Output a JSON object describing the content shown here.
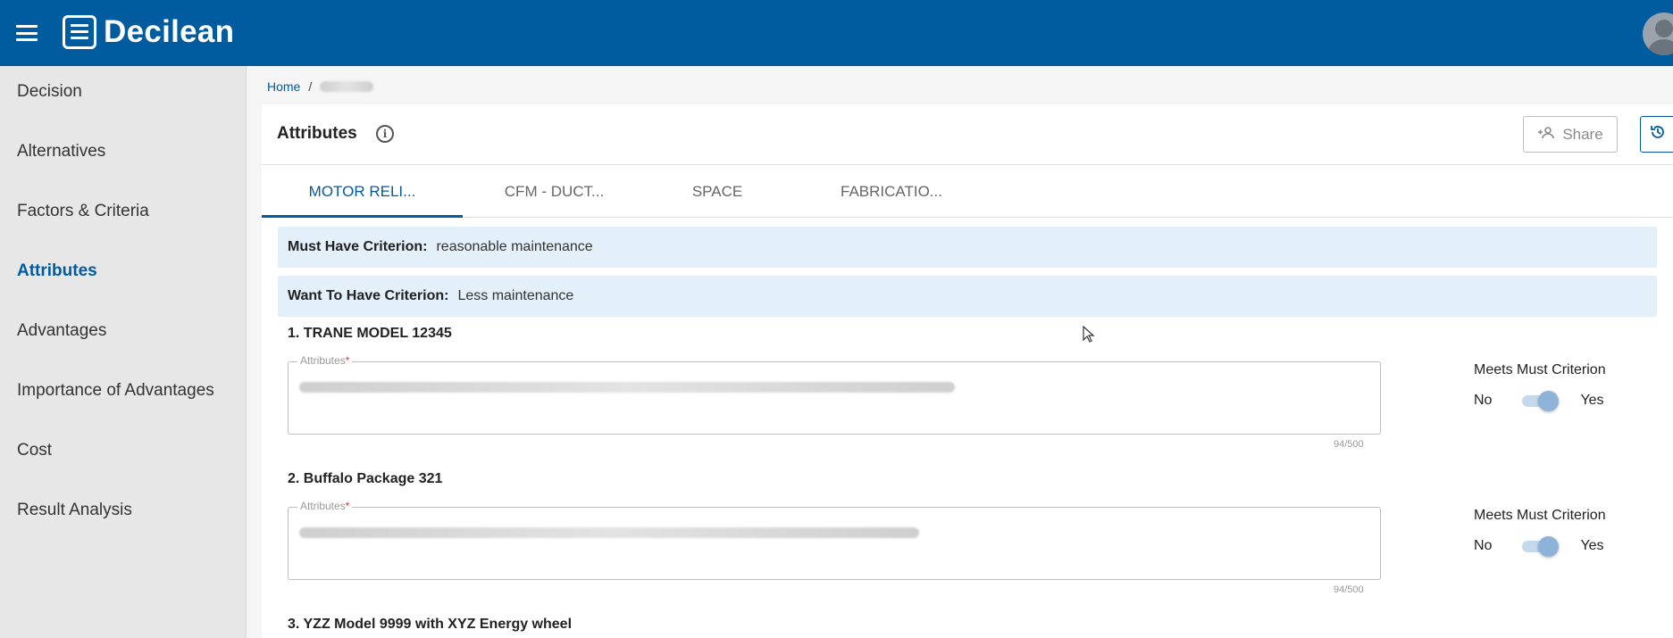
{
  "app": {
    "name": "Decilean"
  },
  "sidebar": {
    "items": [
      {
        "label": "Decision",
        "active": false
      },
      {
        "label": "Alternatives",
        "active": false
      },
      {
        "label": "Factors & Criteria",
        "active": false
      },
      {
        "label": "Attributes",
        "active": true
      },
      {
        "label": "Advantages",
        "active": false
      },
      {
        "label": "Importance of Advantages",
        "active": false
      },
      {
        "label": "Cost",
        "active": false
      },
      {
        "label": "Result Analysis",
        "active": false
      }
    ]
  },
  "breadcrumb": {
    "home": "Home",
    "separator": "/"
  },
  "page": {
    "title": "Attributes"
  },
  "toolbar": {
    "share_label": "Share"
  },
  "tabs": [
    {
      "label": "MOTOR RELI...",
      "active": true
    },
    {
      "label": "CFM - DUCT...",
      "active": false
    },
    {
      "label": "SPACE",
      "active": false
    },
    {
      "label": "FABRICATIO...",
      "active": false
    }
  ],
  "criteria": {
    "must_label": "Must Have Criterion:",
    "must_value": "reasonable maintenance",
    "want_label": "Want To Have Criterion:",
    "want_value": "Less maintenance"
  },
  "alternatives": [
    {
      "title": "1. TRANE MODEL 12345",
      "field_label": "Attributes",
      "required_mark": "*",
      "counter": "94/500",
      "meets_label": "Meets Must Criterion",
      "no_label": "No",
      "yes_label": "Yes",
      "meets": true
    },
    {
      "title": "2. Buffalo Package 321",
      "field_label": "Attributes",
      "required_mark": "*",
      "counter": "94/500",
      "meets_label": "Meets Must Criterion",
      "no_label": "No",
      "yes_label": "Yes",
      "meets": true
    },
    {
      "title": "3. YZZ Model 9999 with XYZ Energy wheel"
    }
  ],
  "colors": {
    "brand": "#005b9f",
    "sidebar_bg": "#e7e7e7",
    "criterion_bg": "#e3eff9"
  }
}
